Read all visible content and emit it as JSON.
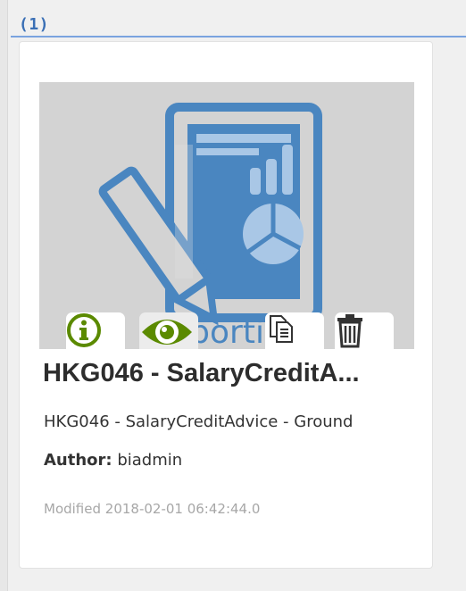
{
  "group": {
    "header": "(1)"
  },
  "report": {
    "thumbnail_text": "reporting",
    "title": "HKG046 - SalaryCreditA...",
    "description": "HKG046 - SalaryCreditAdvice - Ground",
    "author_label": "Author:",
    "author": "biadmin",
    "modified": "Modified 2018-02-01 06:42:44.0"
  },
  "actions": [
    {
      "icon": "info-icon",
      "color": "#5b8a00"
    },
    {
      "icon": "eye-icon",
      "color": "#5b8a00"
    },
    {
      "icon": "copy-icon",
      "color": "#333333"
    },
    {
      "icon": "trash-icon",
      "color": "#333333"
    }
  ],
  "colors": {
    "accent": "#3a6fb5",
    "thumbnail_blue": "#4a86c0",
    "action_green": "#5b8a00"
  }
}
